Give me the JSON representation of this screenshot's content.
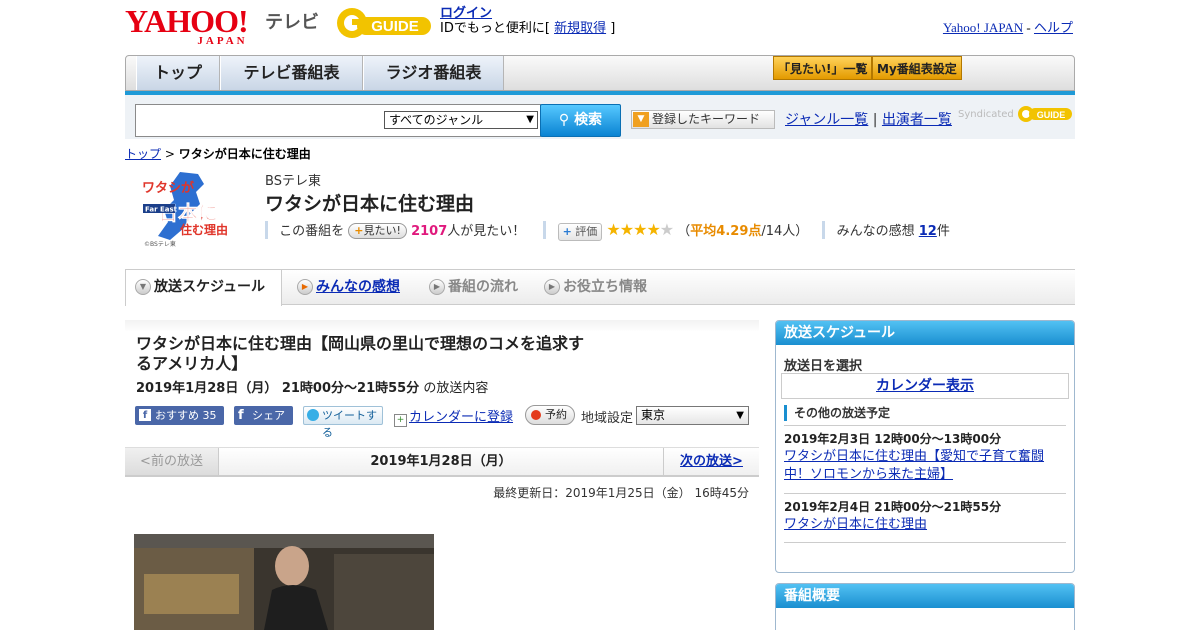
{
  "header": {
    "yahoo_logo": "YAHOO!",
    "yahoo_logo_sub": "JAPAN",
    "tv_label": "テレビ",
    "gguide_logo": "G GUIDE",
    "login": "ログイン",
    "login_note_pre": "IDでもっと便利に[",
    "signup": "新規取得",
    "login_note_post": "]",
    "yahoo_japan_link": "Yahoo! JAPAN",
    "separator": "-",
    "help_link": "ヘルプ"
  },
  "nav": {
    "tabs": [
      "トップ",
      "テレビ番組表",
      "ラジオ番組表"
    ],
    "mitai_list": "「見たい!」一覧",
    "my_listing": "My番組表設定"
  },
  "search": {
    "genre_select": "すべてのジャンル",
    "search_button": "検索",
    "keyword_button": "登録したキーワード",
    "genre_list": "ジャンル一覧",
    "pipe": "|",
    "performer_list": "出演者一覧",
    "syndicated": "Syndicated"
  },
  "breadcrumb": {
    "top": "トップ",
    "sep": ">",
    "current": "ワタシが日本に住む理由"
  },
  "program": {
    "logo_text_1": "ワタシが",
    "logo_text_2": "日本に",
    "logo_text_3": "住む理由",
    "logo_far_east": "Far East",
    "logo_credit": "©BSテレ東",
    "channel": "BSテレ東",
    "title": "ワタシが日本に住む理由",
    "mitai_pre": "この番組を",
    "mitai_button": "見たい!",
    "mitai_count": "2107",
    "mitai_post": "人が見たい！",
    "hyoka_button": "評価",
    "rating_stars": 4,
    "rating_open": "（",
    "rating_avg": "平均4.29点",
    "rating_post": "/14人）",
    "kansou_label": "みんなの感想",
    "kansou_count": "12",
    "kansou_unit": "件"
  },
  "subtabs": [
    "放送スケジュール",
    "みんなの感想",
    "番組の流れ",
    "お役立ち情報"
  ],
  "episode": {
    "title": "ワタシが日本に住む理由【岡山県の里山で理想のコメを追求するアメリカ人】",
    "date": "2019年1月28日（月） 21時00分～21時55分",
    "date_suffix": "の放送内容",
    "fb_recommend": "おすすめ 35",
    "fb_share": "シェア",
    "tweet": "ツイートする",
    "calendar_register": "カレンダーに登録",
    "reserve": "予約",
    "region_label": "地域設定",
    "region_value": "東京",
    "prev": "<前の放送",
    "current_date": "2019年1月28日（月）",
    "next": "次の放送>",
    "updated": "最終更新日：2019年1月25日（金） 16時45分"
  },
  "sidebar": {
    "schedule_title": "放送スケジュール",
    "select_date": "放送日を選択",
    "calendar_show": "カレンダー表示",
    "other_title": "その他の放送予定",
    "items": [
      {
        "date": "2019年2月3日  12時00分～13時00分",
        "title": "ワタシが日本に住む理由【愛知で子育て奮闘中！ソロモンから来た主婦】"
      },
      {
        "date": "2019年2月4日  21時00分～21時55分",
        "title": "ワタシが日本に住む理由"
      }
    ],
    "overview_title": "番組概要"
  },
  "colors": {
    "brand_red": "#e60012",
    "accent_blue": "#1a8fd0",
    "link": "#0b2bb5",
    "pink_count": "#e0197d",
    "star": "#f5b400"
  }
}
